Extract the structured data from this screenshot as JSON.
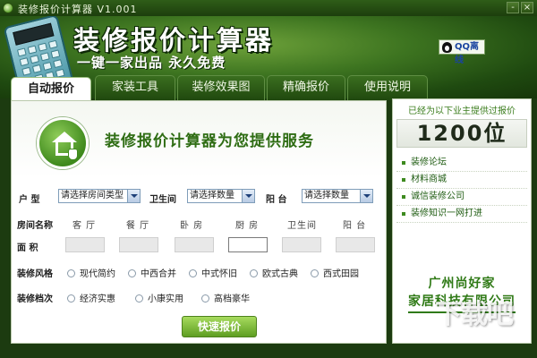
{
  "window": {
    "title": "装修报价计算器    V1.001",
    "minimize": "-",
    "close": "×"
  },
  "header": {
    "title": "装修报价计算器",
    "subtitle": "一键一家出品 永久免费",
    "qq_label": "QQ离线"
  },
  "tabs": [
    "自动报价",
    "家装工具",
    "装修效果图",
    "精确报价",
    "使用说明"
  ],
  "main": {
    "service_text": "装修报价计算器为您提供服务",
    "room_type_label": "户 型",
    "room_type_value": "请选择房间类型",
    "bathroom_label": "卫生间",
    "bathroom_value": "请选择数量",
    "balcony_label": "阳 台",
    "balcony_value": "请选择数量",
    "room_name_label": "房间名称",
    "room_columns": [
      "客 厅",
      "餐 厅",
      "卧 房",
      "厨 房",
      "卫生间",
      "阳 台"
    ],
    "area_label": "面 积",
    "style_label": "装修风格",
    "styles": [
      "现代简约",
      "中西合并",
      "中式怀旧",
      "欧式古典",
      "西式田园"
    ],
    "grade_label": "装修档次",
    "grades": [
      "经济实惠",
      "小康实用",
      "高档豪华"
    ],
    "quick_quote": "快速报价"
  },
  "sidebar": {
    "served_text": "已经为以下业主提供过报价",
    "count": "1200位",
    "links": [
      "装修论坛",
      "材料商城",
      "诚信装修公司",
      "装修知识一网打进"
    ],
    "company_line1": "广州尚好家",
    "company_line2": "家居科技有限公司"
  },
  "watermark": {
    "big": "下载吧",
    "small": "www.xiazaiba.com"
  }
}
